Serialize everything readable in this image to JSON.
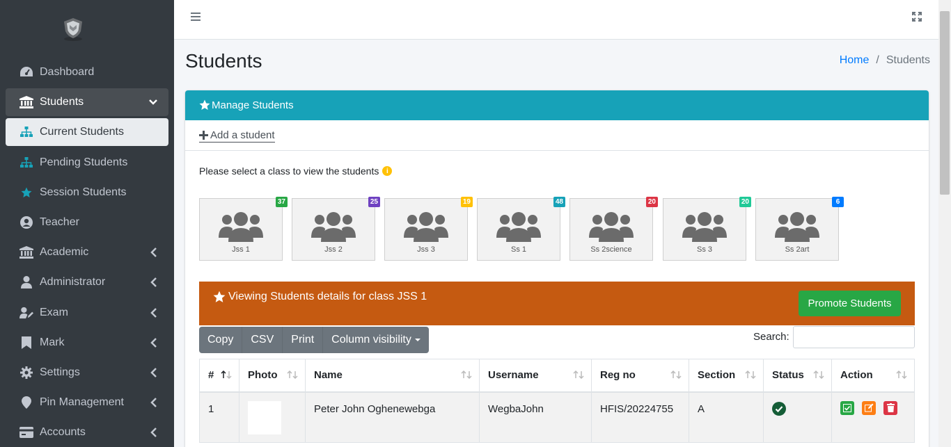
{
  "sidebar": {
    "items": [
      {
        "label": "Dashboard",
        "icon": "tachometer-icon"
      },
      {
        "label": "Students",
        "icon": "university-icon"
      },
      {
        "label": "Current Students",
        "icon": "sitemap-icon"
      },
      {
        "label": "Pending Students",
        "icon": "sitemap-icon"
      },
      {
        "label": "Session Students",
        "icon": "star-icon"
      },
      {
        "label": "Teacher",
        "icon": "user-circle-icon"
      },
      {
        "label": "Academic",
        "icon": "university-icon"
      },
      {
        "label": "Administrator",
        "icon": "user-icon"
      },
      {
        "label": "Exam",
        "icon": "user-edit-icon"
      },
      {
        "label": "Mark",
        "icon": "bookmark-icon"
      },
      {
        "label": "Settings",
        "icon": "gear-icon"
      },
      {
        "label": "Pin Management",
        "icon": "map-marker-icon"
      },
      {
        "label": "Accounts",
        "icon": "credit-card-icon"
      }
    ]
  },
  "header": {
    "title": "Students",
    "breadcrumb_home": "Home",
    "breadcrumb_current": "Students",
    "breadcrumb_sep": "/"
  },
  "card": {
    "title": "Manage Students",
    "add_label": "Add a student",
    "select_message": "Please select a class to view the students"
  },
  "classes": [
    {
      "name": "Jss 1",
      "count": "37",
      "color": "#28a745"
    },
    {
      "name": "Jss 2",
      "count": "25",
      "color": "#6f42c1"
    },
    {
      "name": "Jss 3",
      "count": "19",
      "color": "#ffc107"
    },
    {
      "name": "Ss 1",
      "count": "48",
      "color": "#17a2b8"
    },
    {
      "name": "Ss 2science",
      "count": "20",
      "color": "#dc3545"
    },
    {
      "name": "Ss 3",
      "count": "20",
      "color": "#20c997"
    },
    {
      "name": "Ss 2art",
      "count": "6",
      "color": "#007bff"
    }
  ],
  "viewing": {
    "title": "Viewing Students details for class JSS 1",
    "promote_label": "Promote Students"
  },
  "toolbar": {
    "copy": "Copy",
    "csv": "CSV",
    "print": "Print",
    "column_visibility": "Column visibility",
    "search_label": "Search:"
  },
  "table": {
    "columns": [
      "#",
      "Photo",
      "Name",
      "Username",
      "Reg no",
      "Section",
      "Status",
      "Action"
    ],
    "rows": [
      {
        "num": "1",
        "name": "Peter John Oghenewebga",
        "username": "WegbaJohn",
        "reg_no": "HFIS/20224755",
        "section": "A"
      }
    ]
  },
  "colors": {
    "sidebar_bg": "#343a40",
    "header_teal": "#17a2b8",
    "orange": "#c55a11",
    "green": "#28a745"
  }
}
